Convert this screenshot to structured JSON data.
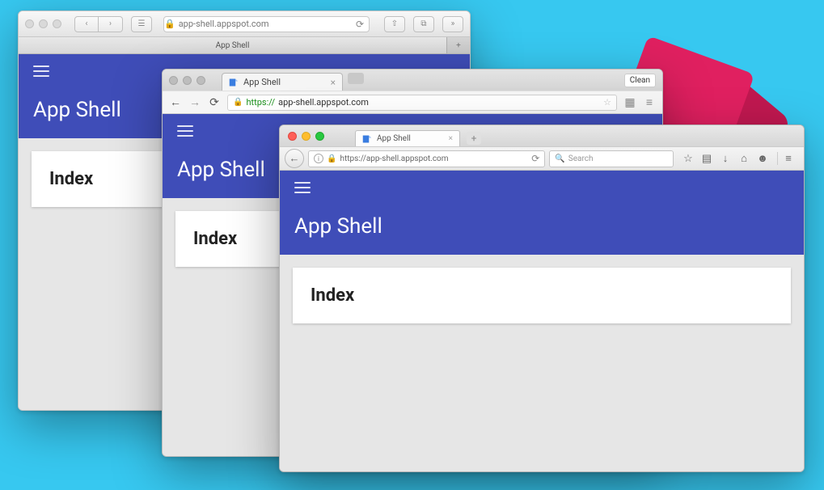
{
  "app": {
    "title": "App Shell",
    "card_heading": "Index"
  },
  "safari": {
    "address_display": "app-shell.appspot.com",
    "tab_label": "App Shell"
  },
  "chrome": {
    "tab_label": "App Shell",
    "clean_button": "Clean",
    "url_protocol": "https://",
    "url_host": "app-shell.appspot.com"
  },
  "firefox": {
    "tab_label": "App Shell",
    "url": "https://app-shell.appspot.com",
    "search_placeholder": "Search"
  }
}
